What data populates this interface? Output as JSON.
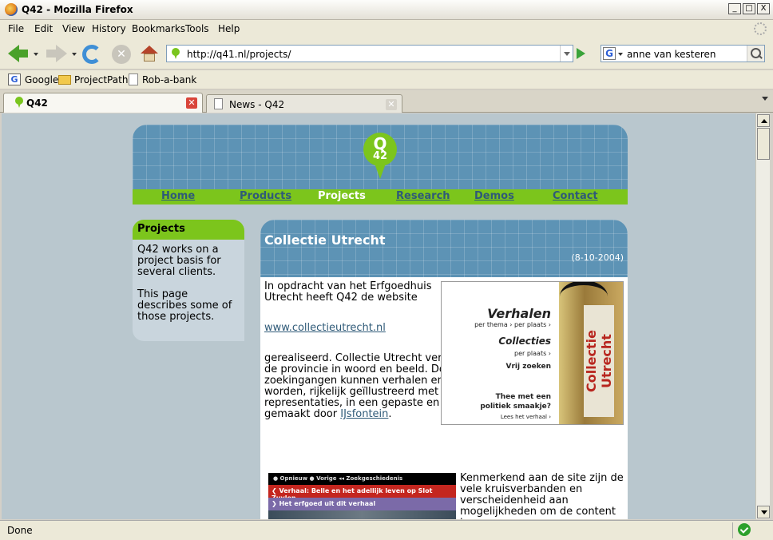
{
  "window": {
    "title": "Q42 - Mozilla Firefox",
    "min": "_",
    "max": "□",
    "close": "X"
  },
  "menu": [
    "File",
    "Edit",
    "View",
    "History",
    "Bookmarks",
    "Tools",
    "Help"
  ],
  "nav": {
    "url": "http://q41.nl/projects/",
    "search_value": "anne van kesteren",
    "search_engine": "G"
  },
  "bookmarks": [
    "Google",
    "ProjectPath",
    "Rob-a-bank"
  ],
  "tabs": [
    {
      "label": "Q42",
      "active": true
    },
    {
      "label": "News - Q42",
      "active": false
    }
  ],
  "status": {
    "text": "Done"
  },
  "site": {
    "logo": {
      "q": "Q",
      "n": "42"
    },
    "nav": [
      "Home",
      "Products",
      "Projects",
      "Research",
      "Demos",
      "Contact"
    ],
    "current_nav": "Projects",
    "sidebar": {
      "title": "Projects",
      "p1": "Q42 works on a project basis for several clients.",
      "p2": "This page describes some of those projects."
    },
    "article": {
      "title": "Collectie Utrecht",
      "date": "(8-10-2004)",
      "intro": "In opdracht van het Erfgoedhuis Utrecht heeft Q42 de website",
      "link": "www.collectieutrecht.nl",
      "body": "gerealiseerd. Collectie Utrecht vertelt de geschiedenis van de provincie in woord en beeld. Door verschillende zoekingangen kunnen verhalen en voorwerpen gevonden worden, rijkelijk geïllustreerd met afbeeldingen, 3-d representaties, in een gepaste en dynamische vormgeving, gemaakt door",
      "body_link": "IJsfontein",
      "body_end": ".",
      "para2": "Kenmerkend aan de site zijn de vele kruisverbanden en verscheidenheid aan mogelijkheden om de content te"
    },
    "promo": {
      "verhalen": "Verhalen",
      "verhalen_sub": "per thema › per plaats ›",
      "collecties": "Collecties",
      "collecties_sub": "per plaats ›",
      "vrij": "Vrij zoeken",
      "thee1": "Thee met een",
      "thee2": "politiek smaakje?",
      "lees": "Lees het verhaal ›",
      "brand": "Collectie Utrecht"
    },
    "screenshot": {
      "row1": "● Opnieuw   ● Vorige   ◂◂ Zoekgeschiedenis",
      "row2": "❮ Verhaal: Belle en het adellijk leven op Slot Zuylen",
      "row3": "❯ Het erfgoed uit dit verhaal"
    }
  }
}
